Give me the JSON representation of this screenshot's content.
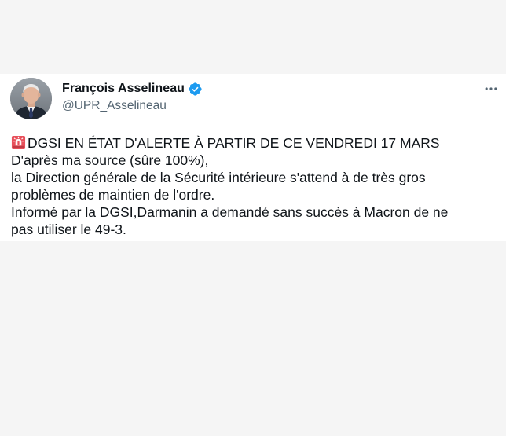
{
  "tweet": {
    "author": {
      "display_name": "François Asselineau",
      "handle": "@UPR_Asselineau",
      "verified": true,
      "verified_color": "#1d9bf0"
    },
    "more_icon": "more-horizontal-icon",
    "emoji_icon": "police-siren-icon",
    "lines": [
      "DGSI EN ÉTAT D'ALERTE À PARTIR DE CE VENDREDI 17 MARS",
      "D'après ma source (sûre 100%),",
      "la Direction générale de la Sécurité intérieure s'attend à de très gros",
      "problèmes de maintien de l'ordre.",
      "Informé par la DGSI,Darmanin a demandé sans succès à Macron de ne",
      "pas utiliser le 49-3."
    ]
  }
}
